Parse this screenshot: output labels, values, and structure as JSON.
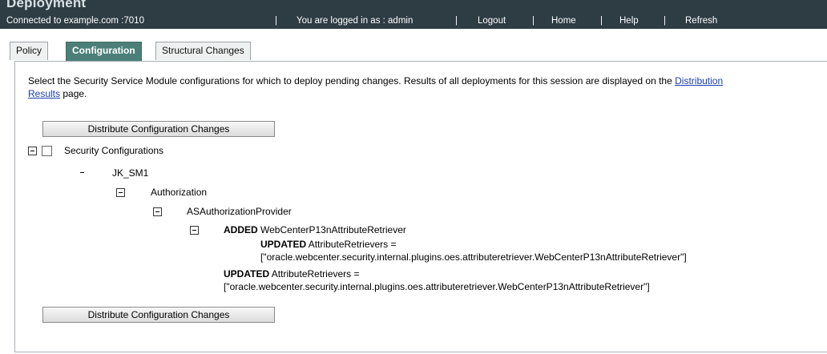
{
  "app": {
    "title": "Deployment"
  },
  "topbar": {
    "connected": "Connected to  example.com :7010",
    "logged_in": "You are logged in as :  admin",
    "logout": "Logout",
    "home": "Home",
    "help": "Help",
    "refresh": "Refresh",
    "separator": "|"
  },
  "tabs": [
    {
      "label": "Policy"
    },
    {
      "label": "Configuration"
    },
    {
      "label": "Structural Changes"
    }
  ],
  "intro": {
    "text": "Select the Security Service Module configurations for which to deploy pending changes. Results of all deployments for this session are displayed on the ",
    "link1": "Distribution",
    "link2": "Results",
    "text_after": " page."
  },
  "buttons": {
    "distribute": "Distribute Configuration Changes"
  },
  "tree": {
    "root": "Security Configurations",
    "sm": "JK_SM1",
    "authorization": "Authorization",
    "provider": "ASAuthorizationProvider",
    "added_tag": "ADDED",
    "added_name": "WebCenterP13nAttributeRetriever",
    "updated_tag": "UPDATED",
    "updated1_attr": "AttributeRetrievers =",
    "updated1_value": "[\"oracle.webcenter.security.internal.plugins.oes.attributeretriever.WebCenterP13nAttributeRetriever\"]",
    "updated2_attr": "AttributeRetrievers =",
    "updated2_value": "[\"oracle.webcenter.security.internal.plugins.oes.attributeretriever.WebCenterP13nAttributeRetriever\"]"
  }
}
